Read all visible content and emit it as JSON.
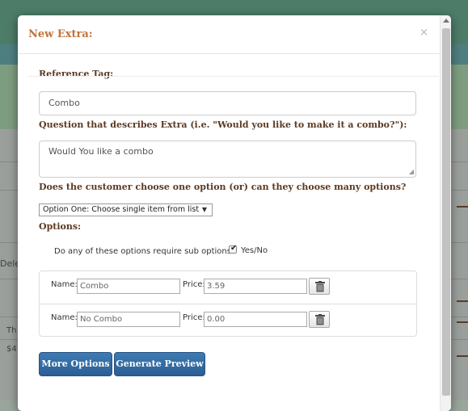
{
  "modal": {
    "title": "New Extra:",
    "close": "×"
  },
  "form": {
    "reference_tag_label": "Reference Tag:",
    "reference_tag_value": "Combo",
    "question_label": "Question that describes Extra (i.e. \"Would you like to make it a combo?\"):",
    "question_value": "Would You like a combo",
    "choice_label": "Does the customer choose one option (or) can they choose many options?",
    "choice_selected": "Option One: Choose single item from list",
    "options_label": "Options:",
    "sub_options_question": "Do any of these options require sub options?",
    "sub_options_checked": true,
    "sub_options_checkbox_label": "Yes/No",
    "option_rows": [
      {
        "name_label": "Name:",
        "name_value": "Combo",
        "price_label": "Price:",
        "price_value": "3.59"
      },
      {
        "name_label": "Name:",
        "name_value": "No Combo",
        "price_label": "Price:",
        "price_value": "0.00"
      }
    ],
    "more_options_button": "More Options",
    "generate_preview_button": "Generate Preview"
  },
  "background": {
    "fragment_del": "Dele",
    "fragment_th": "Th",
    "fragment_price": "$4"
  },
  "colors": {
    "title": "#c0733d",
    "label": "#5b3a22",
    "button": "#2f6aa3"
  }
}
